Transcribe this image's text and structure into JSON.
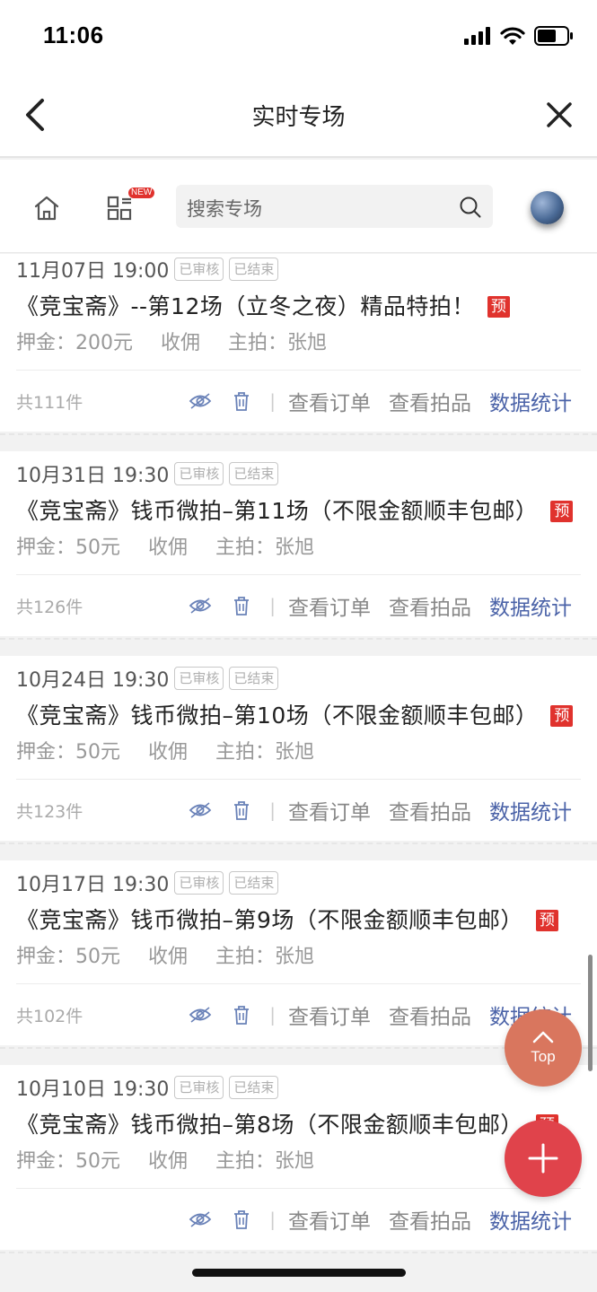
{
  "status_bar": {
    "time": "11:06"
  },
  "nav": {
    "title": "实时专场"
  },
  "toolbar": {
    "new_badge": "NEW",
    "search_placeholder": "搜索专场"
  },
  "sessions": [
    {
      "date": "11月07日 19:00",
      "tags": [
        "已审核",
        "已结束"
      ],
      "title": "《竞宝斋》--第12场（立冬之夜）精品特拍！",
      "badge": "预",
      "deposit": "押金：200元",
      "fee": "收佣",
      "host": "主拍：张旭",
      "count": "共111件",
      "actions": [
        "查看订单",
        "查看拍品",
        "数据统计"
      ]
    },
    {
      "date": "10月31日 19:30",
      "tags": [
        "已审核",
        "已结束"
      ],
      "title": "《竞宝斋》钱币微拍–第11场（不限金额顺丰包邮）",
      "badge": "预",
      "deposit": "押金：50元",
      "fee": "收佣",
      "host": "主拍：张旭",
      "count": "共126件",
      "actions": [
        "查看订单",
        "查看拍品",
        "数据统计"
      ]
    },
    {
      "date": "10月24日 19:30",
      "tags": [
        "已审核",
        "已结束"
      ],
      "title": "《竞宝斋》钱币微拍–第10场（不限金额顺丰包邮）",
      "badge": "预",
      "deposit": "押金：50元",
      "fee": "收佣",
      "host": "主拍：张旭",
      "count": "共123件",
      "actions": [
        "查看订单",
        "查看拍品",
        "数据统计"
      ]
    },
    {
      "date": "10月17日 19:30",
      "tags": [
        "已审核",
        "已结束"
      ],
      "title": "《竞宝斋》钱币微拍–第9场（不限金额顺丰包邮）",
      "badge": "预",
      "deposit": "押金：50元",
      "fee": "收佣",
      "host": "主拍：张旭",
      "count": "共102件",
      "actions": [
        "查看订单",
        "查看拍品",
        "数据统计"
      ]
    },
    {
      "date": "10月10日 19:30",
      "tags": [
        "已审核",
        "已结束"
      ],
      "title": "《竞宝斋》钱币微拍–第8场（不限金额顺丰包邮）",
      "badge": "预",
      "deposit": "押金：50元",
      "fee": "收佣",
      "host": "主拍：张旭",
      "count": "",
      "actions": [
        "查看订单",
        "查看拍品",
        "数据统计"
      ]
    }
  ],
  "floating": {
    "top_label": "Top"
  },
  "colors": {
    "accent_red": "#e0322d",
    "link_blue": "#4b63a8",
    "top_button": "#d9765e",
    "add_button": "#e0434b"
  }
}
